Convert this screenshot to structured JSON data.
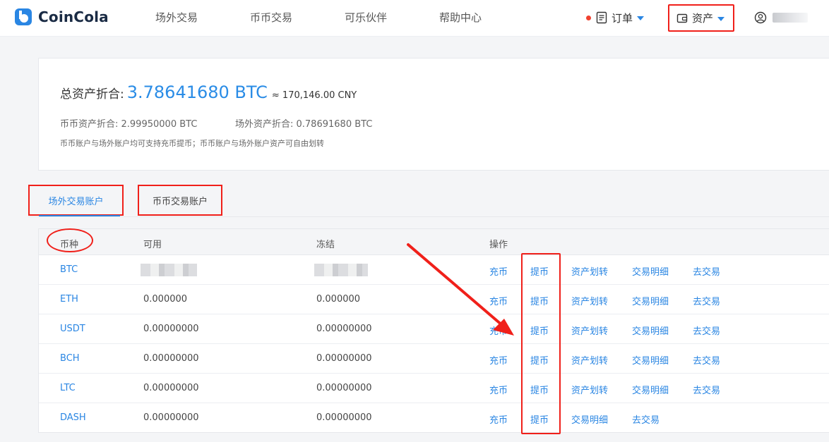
{
  "brand": {
    "name": "CoinCola"
  },
  "nav": {
    "items": [
      "场外交易",
      "币币交易",
      "可乐伙伴",
      "帮助中心"
    ],
    "order_label": "订单",
    "asset_label": "资产"
  },
  "colors": {
    "accent": "#2a86e3",
    "annotation_red": "#f0201a",
    "alert_dot": "#f0412f"
  },
  "summary": {
    "total_label": "总资产折合:",
    "total_value": "3.78641680 BTC",
    "approx": "≈ 170,146.00 CNY",
    "spot_label": "币币资产折合: 2.99950000 BTC",
    "otc_label": "场外资产折合: 0.78691680 BTC",
    "note": "币币账户与场外账户均可支持充币提币；币币账户与场外账户资产可自由划转"
  },
  "tabs": [
    {
      "label": "场外交易账户",
      "active": true
    },
    {
      "label": "币币交易账户",
      "active": false
    }
  ],
  "table": {
    "headers": [
      "币种",
      "可用",
      "冻结",
      "操作"
    ],
    "rows": [
      {
        "coin": "BTC",
        "available": "",
        "frozen": "",
        "actions": [
          "充币",
          "提币",
          "资产划转",
          "交易明细",
          "去交易"
        ]
      },
      {
        "coin": "ETH",
        "available": "0.000000",
        "frozen": "0.000000",
        "actions": [
          "充币",
          "提币",
          "资产划转",
          "交易明细",
          "去交易"
        ]
      },
      {
        "coin": "USDT",
        "available": "0.00000000",
        "frozen": "0.00000000",
        "actions": [
          "充币",
          "提币",
          "资产划转",
          "交易明细",
          "去交易"
        ]
      },
      {
        "coin": "BCH",
        "available": "0.00000000",
        "frozen": "0.00000000",
        "actions": [
          "充币",
          "提币",
          "资产划转",
          "交易明细",
          "去交易"
        ]
      },
      {
        "coin": "LTC",
        "available": "0.00000000",
        "frozen": "0.00000000",
        "actions": [
          "充币",
          "提币",
          "资产划转",
          "交易明细",
          "去交易"
        ]
      },
      {
        "coin": "DASH",
        "available": "0.00000000",
        "frozen": "0.00000000",
        "actions": [
          "充币",
          "提币",
          "交易明细",
          "去交易"
        ]
      }
    ]
  }
}
